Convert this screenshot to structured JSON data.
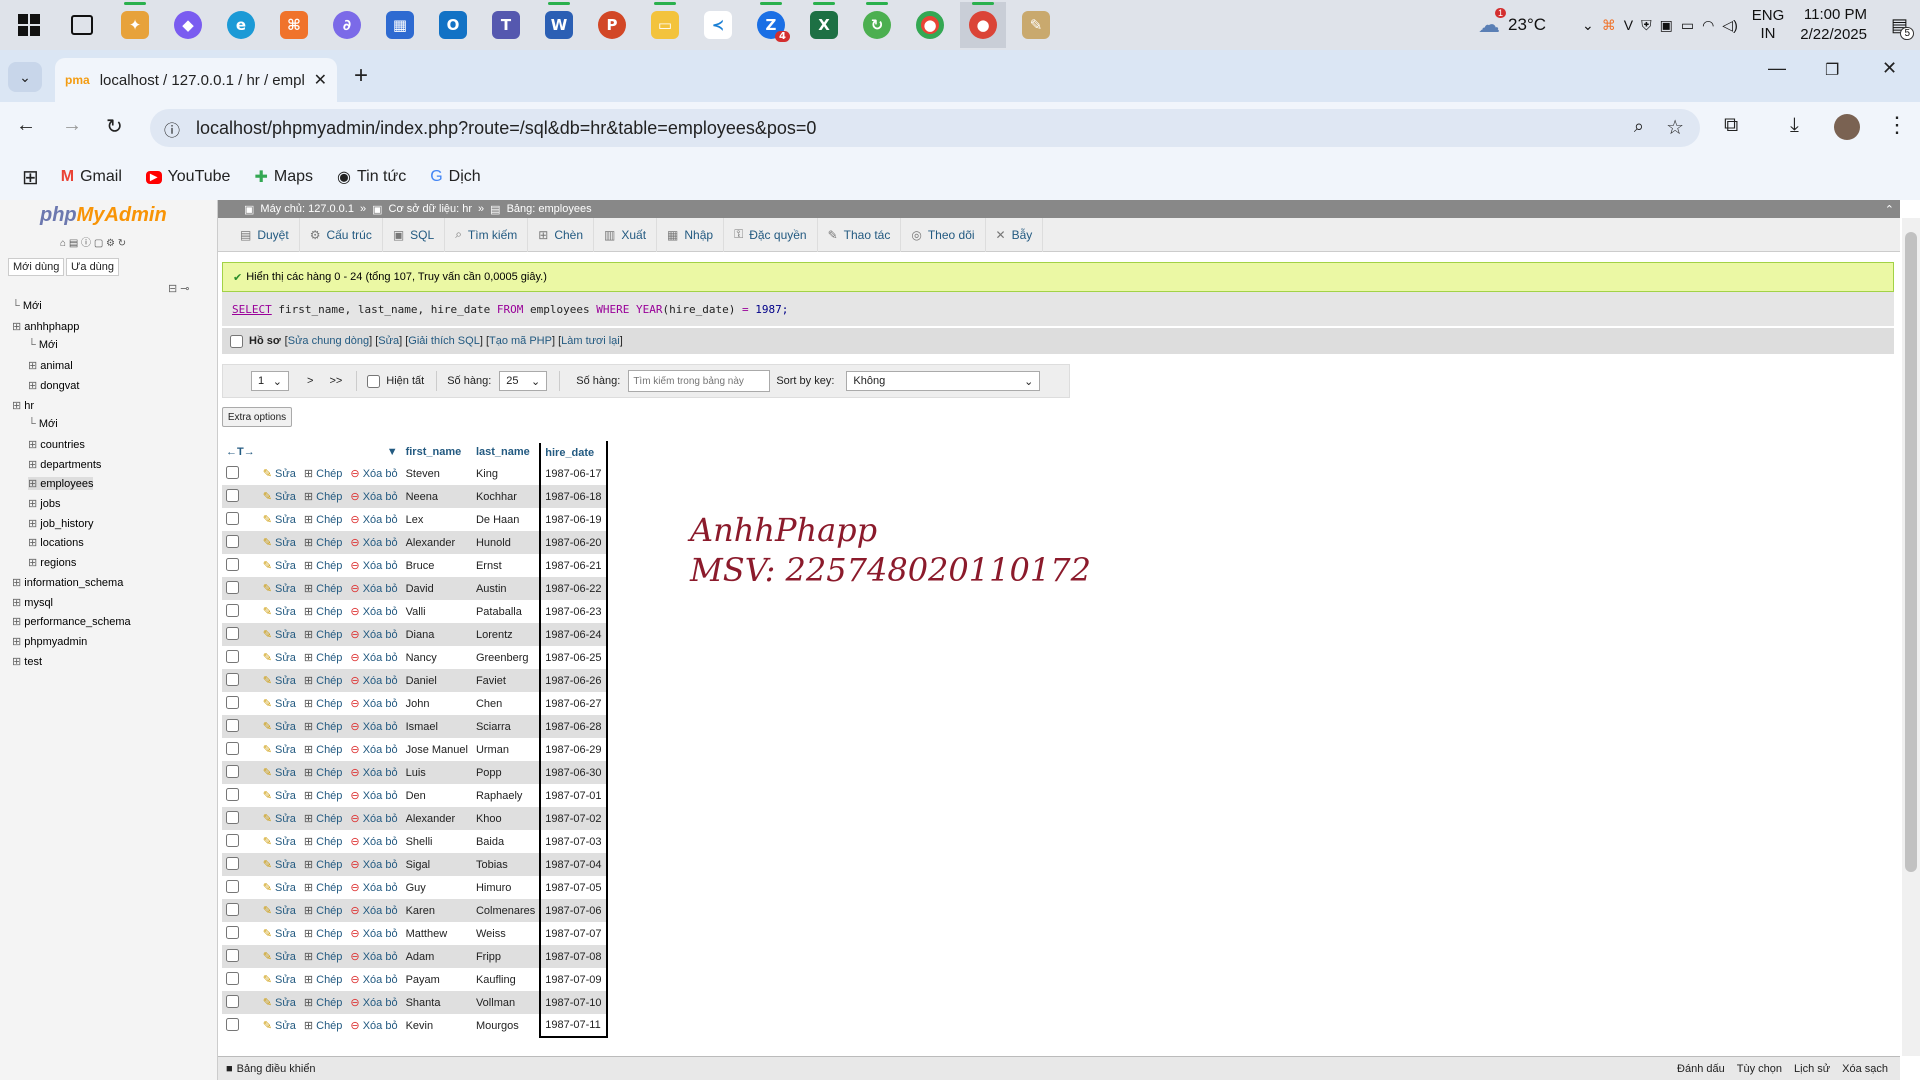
{
  "taskbar": {
    "weather_temp": "23°C",
    "weather_badge": "1",
    "lang": "ENG",
    "region": "IN",
    "time": "11:00 PM",
    "date": "2/22/2025",
    "notif_count": "5",
    "teams_badge": "4"
  },
  "browser": {
    "tab_title": "localhost / 127.0.0.1 / hr / empl",
    "url": "localhost/phpmyadmin/index.php?route=/sql&db=hr&table=employees&pos=0",
    "bookmarks": [
      "Gmail",
      "YouTube",
      "Maps",
      "Tin tức",
      "Dịch"
    ]
  },
  "pma": {
    "logo_php": "php",
    "logo_myadmin": "MyAdmin",
    "recent": "Mới dùng",
    "favorites": "Ưa dùng",
    "tree": [
      {
        "label": "Mới",
        "level": 0
      },
      {
        "label": "anhhphapp",
        "level": 0
      },
      {
        "label": "Mới",
        "level": 1
      },
      {
        "label": "animal",
        "level": 1
      },
      {
        "label": "dongvat",
        "level": 1
      },
      {
        "label": "hr",
        "level": 0
      },
      {
        "label": "Mới",
        "level": 1
      },
      {
        "label": "countries",
        "level": 1
      },
      {
        "label": "departments",
        "level": 1
      },
      {
        "label": "employees",
        "level": 1
      },
      {
        "label": "jobs",
        "level": 1
      },
      {
        "label": "job_history",
        "level": 1
      },
      {
        "label": "locations",
        "level": 1
      },
      {
        "label": "regions",
        "level": 1
      },
      {
        "label": "information_schema",
        "level": 0
      },
      {
        "label": "mysql",
        "level": 0
      },
      {
        "label": "performance_schema",
        "level": 0
      },
      {
        "label": "phpmyadmin",
        "level": 0
      },
      {
        "label": "test",
        "level": 0
      }
    ],
    "breadcrumb": [
      "Máy chủ: 127.0.0.1",
      "Cơ sở dữ liệu: hr",
      "Bảng: employees"
    ],
    "menu": [
      "Duyệt",
      "Cấu trúc",
      "SQL",
      "Tìm kiếm",
      "Chèn",
      "Xuất",
      "Nhập",
      "Đặc quyền",
      "Thao tác",
      "Theo dõi",
      "Bẫy"
    ],
    "success": "Hiển thị các hàng 0 - 24 (tổng 107, Truy vấn cần 0,0005 giây.)",
    "sql": {
      "kw_select": "SELECT",
      "cols": " first_name, last_name, hire_date ",
      "kw_from": "FROM",
      "table": " employees ",
      "kw_where": "WHERE",
      "fn": " YEAR",
      "arg": "(hire_date) ",
      "op": "=",
      "val": " 1987;"
    },
    "profile": {
      "label": "Hồ sơ",
      "links": [
        "Sửa chung dòng",
        "Sửa",
        "Giải thích SQL",
        "Tạo mã PHP",
        "Làm tươi lại"
      ]
    },
    "nav": {
      "page": "1",
      "next": ">",
      "last": ">>",
      "show_all": "Hiện tất",
      "rows_label": "Số hàng:",
      "rows_value": "25",
      "filter_label": "Số hàng:",
      "filter_placeholder": "Tìm kiếm trong bảng này",
      "sort_label": "Sort by key:",
      "sort_value": "Không"
    },
    "extra_options": "Extra options",
    "columns": [
      "first_name",
      "last_name",
      "hire_date"
    ],
    "actions": {
      "edit": "Sửa",
      "copy": "Chép",
      "delete": "Xóa bỏ"
    },
    "rows": [
      [
        "Steven",
        "King",
        "1987-06-17"
      ],
      [
        "Neena",
        "Kochhar",
        "1987-06-18"
      ],
      [
        "Lex",
        "De Haan",
        "1987-06-19"
      ],
      [
        "Alexander",
        "Hunold",
        "1987-06-20"
      ],
      [
        "Bruce",
        "Ernst",
        "1987-06-21"
      ],
      [
        "David",
        "Austin",
        "1987-06-22"
      ],
      [
        "Valli",
        "Pataballa",
        "1987-06-23"
      ],
      [
        "Diana",
        "Lorentz",
        "1987-06-24"
      ],
      [
        "Nancy",
        "Greenberg",
        "1987-06-25"
      ],
      [
        "Daniel",
        "Faviet",
        "1987-06-26"
      ],
      [
        "John",
        "Chen",
        "1987-06-27"
      ],
      [
        "Ismael",
        "Sciarra",
        "1987-06-28"
      ],
      [
        "Jose Manuel",
        "Urman",
        "1987-06-29"
      ],
      [
        "Luis",
        "Popp",
        "1987-06-30"
      ],
      [
        "Den",
        "Raphaely",
        "1987-07-01"
      ],
      [
        "Alexander",
        "Khoo",
        "1987-07-02"
      ],
      [
        "Shelli",
        "Baida",
        "1987-07-03"
      ],
      [
        "Sigal",
        "Tobias",
        "1987-07-04"
      ],
      [
        "Guy",
        "Himuro",
        "1987-07-05"
      ],
      [
        "Karen",
        "Colmenares",
        "1987-07-06"
      ],
      [
        "Matthew",
        "Weiss",
        "1987-07-07"
      ],
      [
        "Adam",
        "Fripp",
        "1987-07-08"
      ],
      [
        "Payam",
        "Kaufling",
        "1987-07-09"
      ],
      [
        "Shanta",
        "Vollman",
        "1987-07-10"
      ],
      [
        "Kevin",
        "Mourgos",
        "1987-07-11"
      ]
    ],
    "watermark_line1": "AnhhPhapp",
    "watermark_line2": "MSV: 225748020110172",
    "console": "Bảng điều khiển",
    "console_links": [
      "Đánh dấu",
      "Tùy chọn",
      "Lịch sử",
      "Xóa sạch"
    ]
  }
}
